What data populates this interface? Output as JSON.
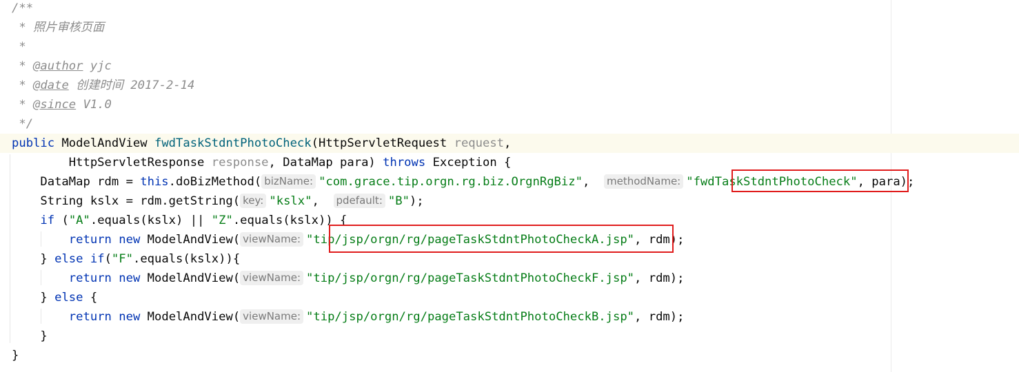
{
  "code": {
    "lines": [
      [
        {
          "t": "cm",
          "v": "/**"
        }
      ],
      [
        {
          "t": "cm",
          "v": " * 照片审核页面"
        }
      ],
      [
        {
          "t": "cm",
          "v": " *"
        }
      ],
      [
        {
          "t": "cm",
          "v": " * "
        },
        {
          "t": "tag",
          "v": "@author"
        },
        {
          "t": "cm",
          "v": " yjc"
        }
      ],
      [
        {
          "t": "cm",
          "v": " * "
        },
        {
          "t": "tag",
          "v": "@date"
        },
        {
          "t": "cm",
          "v": " 创建时间 2017-2-14"
        }
      ],
      [
        {
          "t": "cm",
          "v": " * "
        },
        {
          "t": "tag",
          "v": "@since"
        },
        {
          "t": "cm",
          "v": " V1.0"
        }
      ],
      [
        {
          "t": "cm",
          "v": " */"
        }
      ],
      [
        {
          "t": "kw",
          "v": "public"
        },
        {
          "t": "p",
          "v": " ModelAndView "
        },
        {
          "t": "fn",
          "v": "fwdTaskStdntPhotoCheck"
        },
        {
          "t": "p",
          "v": "(HttpServletRequest "
        },
        {
          "t": "param",
          "v": "request"
        },
        {
          "t": "p",
          "v": ","
        }
      ],
      [
        {
          "t": "p",
          "v": "        HttpServletResponse "
        },
        {
          "t": "param",
          "v": "response"
        },
        {
          "t": "p",
          "v": ", DataMap para) "
        },
        {
          "t": "kw",
          "v": "throws"
        },
        {
          "t": "p",
          "v": " Exception {"
        }
      ],
      [
        {
          "t": "p",
          "v": "    DataMap rdm = "
        },
        {
          "t": "kw",
          "v": "this"
        },
        {
          "t": "p",
          "v": ".doBizMethod("
        },
        {
          "t": "hint",
          "v": "bizName:"
        },
        {
          "t": "str",
          "v": "\"com.grace.tip.orgn.rg.biz.OrgnRgBiz\""
        },
        {
          "t": "p",
          "v": ",  "
        },
        {
          "t": "hint",
          "v": "methodName:"
        },
        {
          "t": "str",
          "v": "\"fwdTaskStdntPhotoCheck\""
        },
        {
          "t": "p",
          "v": ", para);"
        }
      ],
      [
        {
          "t": "p",
          "v": "    String kslx = rdm.getString("
        },
        {
          "t": "hint",
          "v": "key:"
        },
        {
          "t": "str",
          "v": "\"kslx\""
        },
        {
          "t": "p",
          "v": ",  "
        },
        {
          "t": "hint",
          "v": "pdefault:"
        },
        {
          "t": "str",
          "v": "\"B\""
        },
        {
          "t": "p",
          "v": ");"
        }
      ],
      [
        {
          "t": "p",
          "v": "    "
        },
        {
          "t": "kw",
          "v": "if"
        },
        {
          "t": "p",
          "v": " ("
        },
        {
          "t": "str",
          "v": "\"A\""
        },
        {
          "t": "p",
          "v": ".equals(kslx) || "
        },
        {
          "t": "str",
          "v": "\"Z\""
        },
        {
          "t": "p",
          "v": ".equals(kslx)) {"
        }
      ],
      [
        {
          "t": "p",
          "v": "        "
        },
        {
          "t": "kw",
          "v": "return"
        },
        {
          "t": "p",
          "v": " "
        },
        {
          "t": "kw",
          "v": "new"
        },
        {
          "t": "p",
          "v": " ModelAndView("
        },
        {
          "t": "hint",
          "v": "viewName:"
        },
        {
          "t": "str",
          "v": "\"tip/jsp/orgn/rg/pageTaskStdntPhotoCheckA.jsp\""
        },
        {
          "t": "p",
          "v": ", rdm);"
        }
      ],
      [
        {
          "t": "p",
          "v": "    } "
        },
        {
          "t": "kw",
          "v": "else"
        },
        {
          "t": "p",
          "v": " "
        },
        {
          "t": "kw",
          "v": "if"
        },
        {
          "t": "p",
          "v": "("
        },
        {
          "t": "str",
          "v": "\"F\""
        },
        {
          "t": "p",
          "v": ".equals(kslx)){"
        }
      ],
      [
        {
          "t": "p",
          "v": "        "
        },
        {
          "t": "kw",
          "v": "return"
        },
        {
          "t": "p",
          "v": " "
        },
        {
          "t": "kw",
          "v": "new"
        },
        {
          "t": "p",
          "v": " ModelAndView("
        },
        {
          "t": "hint",
          "v": "viewName:"
        },
        {
          "t": "str",
          "v": "\"tip/jsp/orgn/rg/pageTaskStdntPhotoCheckF.jsp\""
        },
        {
          "t": "p",
          "v": ", rdm);"
        }
      ],
      [
        {
          "t": "p",
          "v": "    } "
        },
        {
          "t": "kw",
          "v": "else"
        },
        {
          "t": "p",
          "v": " {"
        }
      ],
      [
        {
          "t": "p",
          "v": "        "
        },
        {
          "t": "kw",
          "v": "return"
        },
        {
          "t": "p",
          "v": " "
        },
        {
          "t": "kw",
          "v": "new"
        },
        {
          "t": "p",
          "v": " ModelAndView("
        },
        {
          "t": "hint",
          "v": "viewName:"
        },
        {
          "t": "str",
          "v": "\"tip/jsp/orgn/rg/pageTaskStdntPhotoCheckB.jsp\""
        },
        {
          "t": "p",
          "v": ", rdm);"
        }
      ],
      [
        {
          "t": "p",
          "v": "    }"
        }
      ],
      [
        {
          "t": "p",
          "v": "}"
        }
      ]
    ],
    "current_line": 7
  },
  "highlight_color": "#e01b1b"
}
